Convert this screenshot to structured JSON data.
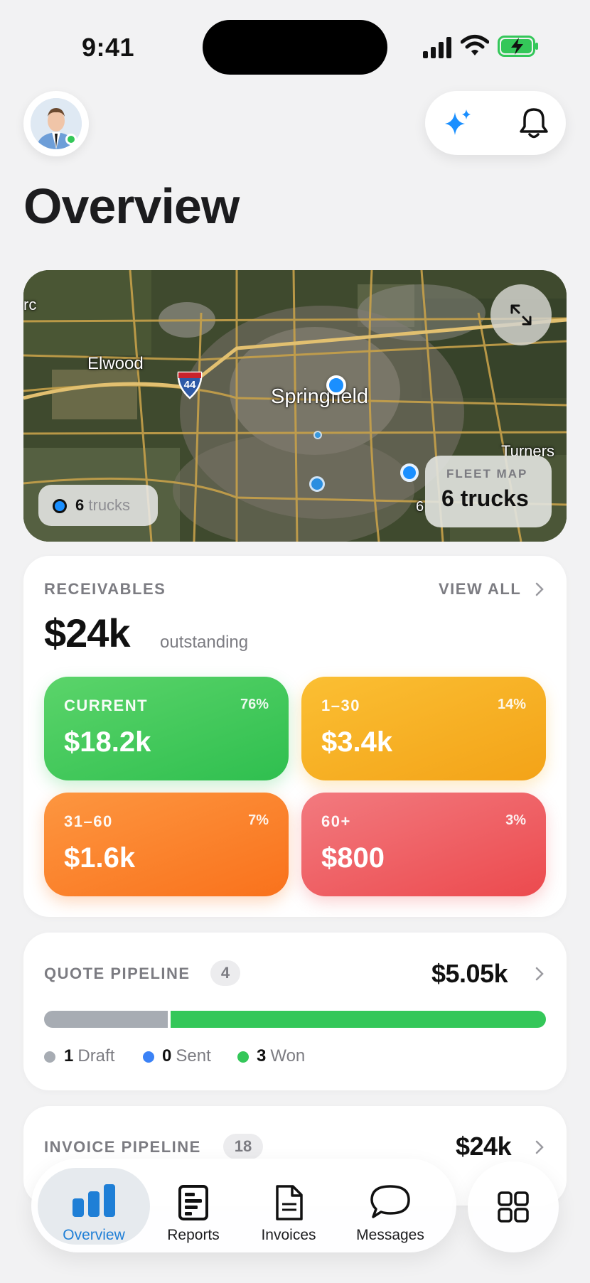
{
  "status_bar": {
    "time": "9:41"
  },
  "header": {
    "title": "Overview"
  },
  "map": {
    "labels": {
      "elwood": "Elwood",
      "springfield": "Springfield",
      "turners": "Turners",
      "edge_left": "rc",
      "edge_right": "6",
      "highway": "44"
    },
    "truck_chip": {
      "count": "6",
      "unit": "trucks"
    },
    "fleet": {
      "label": "FLEET MAP",
      "value": "6 trucks"
    },
    "colors": {
      "truck_marker": "#1a8fff"
    }
  },
  "receivables": {
    "label": "RECEIVABLES",
    "view_all": "VIEW ALL",
    "total": "$24k",
    "total_suffix": "outstanding",
    "buckets": [
      {
        "label": "CURRENT",
        "percent": "76%",
        "amount": "$18.2k",
        "color": "#34c759"
      },
      {
        "label": "1–30",
        "percent": "14%",
        "amount": "$3.4k",
        "color": "#f5a623"
      },
      {
        "label": "31–60",
        "percent": "7%",
        "amount": "$1.6k",
        "color": "#f97a1f"
      },
      {
        "label": "60+",
        "percent": "3%",
        "amount": "$800",
        "color": "#ef4e53"
      }
    ]
  },
  "quote_pipeline": {
    "label": "QUOTE PIPELINE",
    "count": "4",
    "amount": "$5.05k",
    "stages": [
      {
        "count": "1",
        "label": "Draft",
        "color": "#a7acb3"
      },
      {
        "count": "0",
        "label": "Sent",
        "color": "#3b82f6"
      },
      {
        "count": "3",
        "label": "Won",
        "color": "#34c759"
      }
    ]
  },
  "invoice_pipeline": {
    "label": "INVOICE PIPELINE",
    "count": "18",
    "amount": "$24k"
  },
  "tabs": [
    {
      "label": "Overview",
      "icon": "bar-chart-icon",
      "active": true
    },
    {
      "label": "Reports",
      "icon": "report-icon"
    },
    {
      "label": "Invoices",
      "icon": "document-icon"
    },
    {
      "label": "Messages",
      "icon": "chat-bubble-icon"
    }
  ],
  "accent_color": "#1f7fd6"
}
